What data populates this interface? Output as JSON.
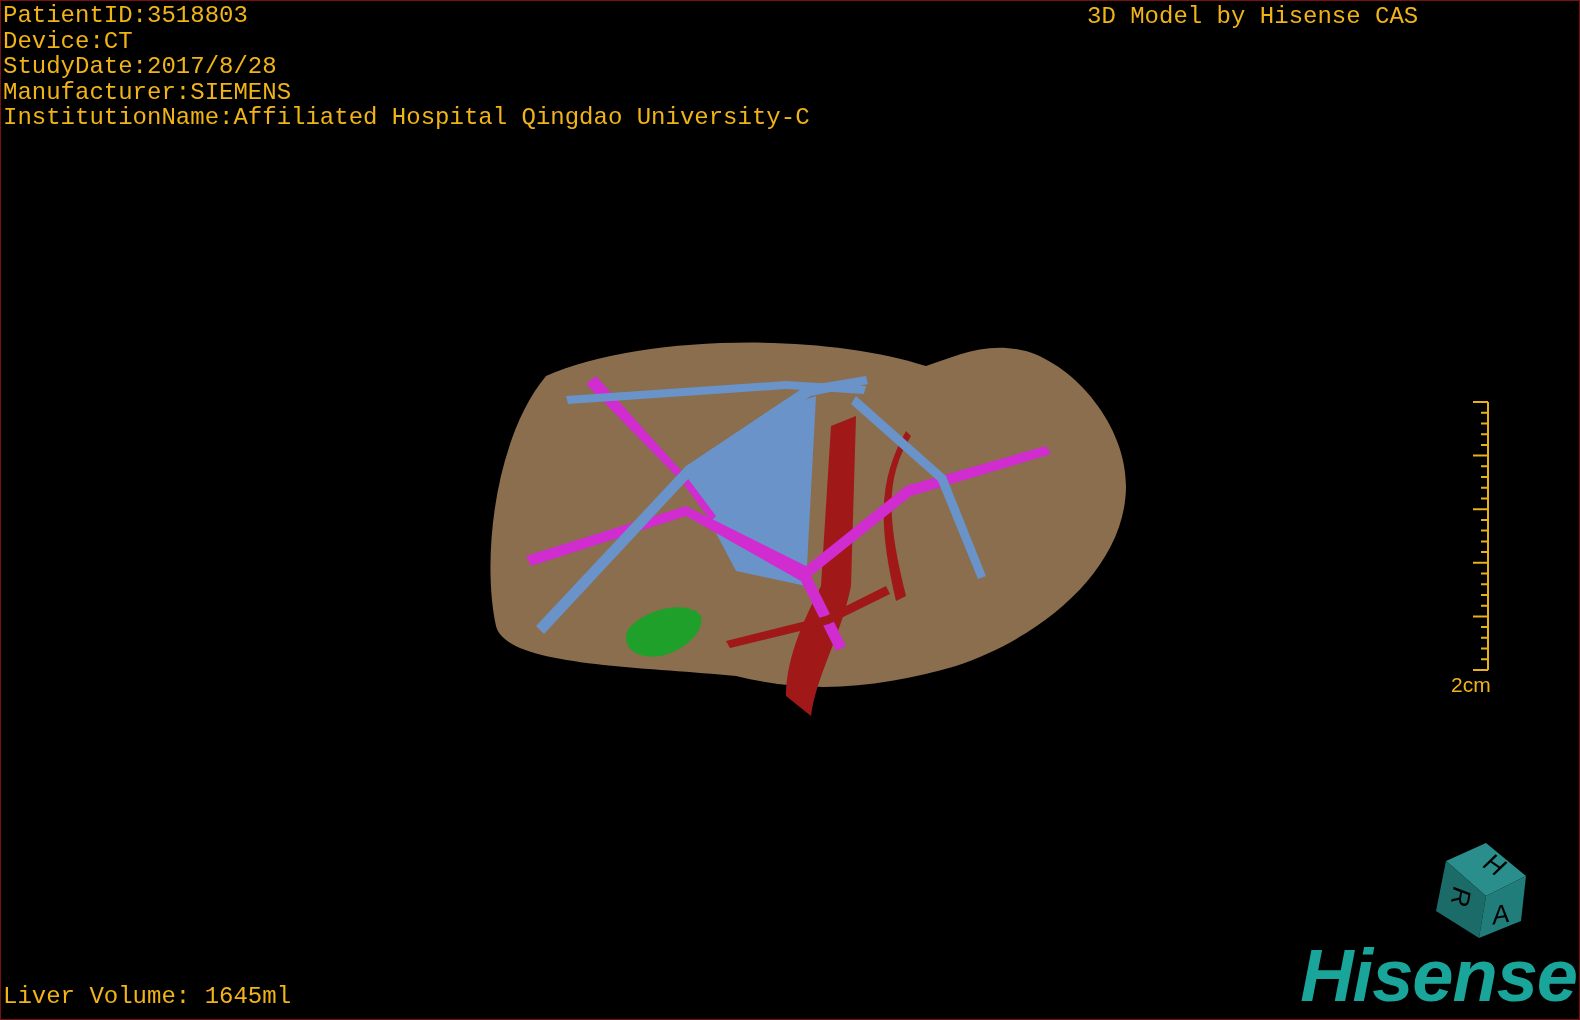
{
  "study_info": [
    "PatientID:3518803",
    "Device:CT",
    "StudyDate:2017/8/28",
    "Manufacturer:SIEMENS",
    "InstitutionName:Affiliated Hospital Qingdao University-C"
  ],
  "viewer_title": "3D Model by Hisense CAS",
  "scale_bar": {
    "label": "2cm"
  },
  "orientation_cube": {
    "faces": [
      "H",
      "R",
      "A"
    ]
  },
  "measurement": "Liver Volume: 1645ml",
  "logo": "Hisense"
}
